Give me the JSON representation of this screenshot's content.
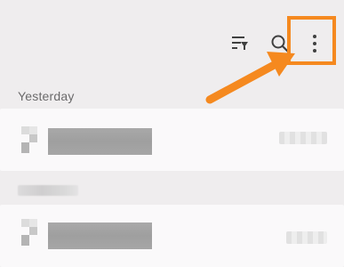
{
  "toolbar": {
    "filter_icon": "filter-list-icon",
    "search_icon": "search-icon",
    "more_icon": "more-vert-icon"
  },
  "annotation": {
    "highlight_color": "#f5891f",
    "arrow_color": "#f5891f"
  },
  "sections": [
    {
      "label": "Yesterday"
    },
    {
      "label": ""
    }
  ],
  "colors": {
    "background": "#efedee",
    "card": "#faf9fa",
    "label": "#6b6a6b"
  }
}
